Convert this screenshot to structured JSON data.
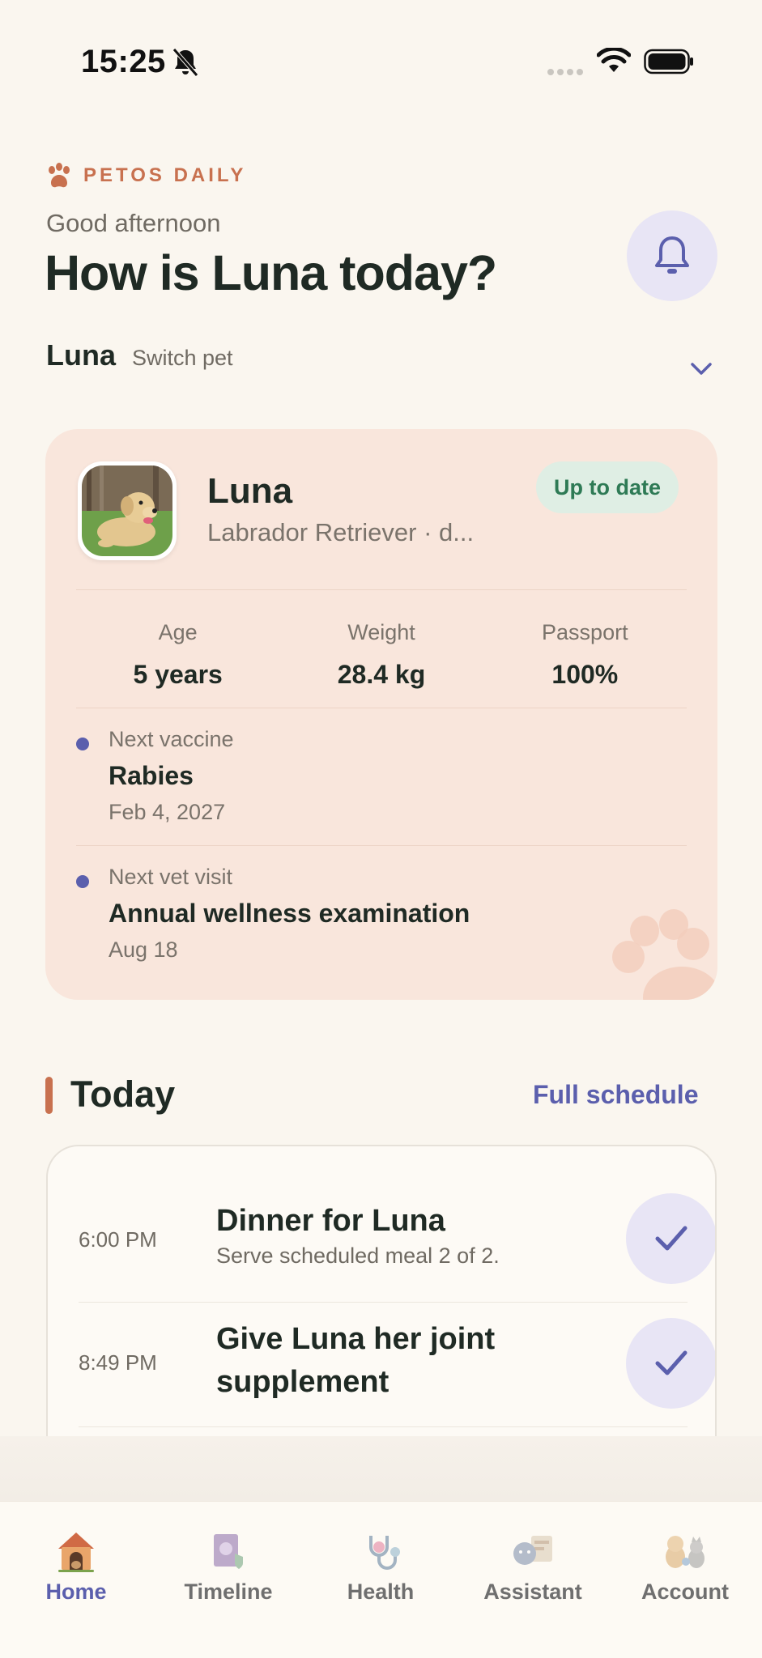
{
  "status_bar": {
    "time": "15:25"
  },
  "header": {
    "brand": "PETOS DAILY",
    "greeting": "Good afternoon",
    "headline": "How is Luna today?"
  },
  "pet_switcher": {
    "pet_name": "Luna",
    "switch_label": "Switch pet"
  },
  "pet_card": {
    "name": "Luna",
    "breed": "Labrador Retriever · d...",
    "badge": "Up to date",
    "stats": [
      {
        "label": "Age",
        "value": "5 years"
      },
      {
        "label": "Weight",
        "value": "28.4 kg"
      },
      {
        "label": "Passport",
        "value": "100%"
      }
    ],
    "events": [
      {
        "label": "Next vaccine",
        "title": "Rabies",
        "date": "Feb 4, 2027"
      },
      {
        "label": "Next vet visit",
        "title": "Annual wellness examination",
        "date": "Aug 18"
      }
    ]
  },
  "today": {
    "title": "Today",
    "link": "Full schedule",
    "tasks": [
      {
        "time": "6:00 PM",
        "title": "Dinner for Luna",
        "subtitle": "Serve scheduled meal 2 of 2."
      },
      {
        "time": "8:49 PM",
        "title_line1": "Give Luna her joint",
        "title_line2": "supplement"
      }
    ]
  },
  "tab_bar": {
    "tabs": [
      {
        "label": "Home",
        "icon": "doghouse-icon",
        "active": true
      },
      {
        "label": "Timeline",
        "icon": "passport-icon",
        "active": false
      },
      {
        "label": "Health",
        "icon": "stethoscope-icon",
        "active": false
      },
      {
        "label": "Assistant",
        "icon": "assistant-icon",
        "active": false
      },
      {
        "label": "Account",
        "icon": "pets-icon",
        "active": false
      }
    ]
  },
  "colors": {
    "background": "#faf6ef",
    "accent": "#5b5fad",
    "brand": "#c8714f",
    "card": "#f9e6dc",
    "success": "#2e7a55"
  }
}
